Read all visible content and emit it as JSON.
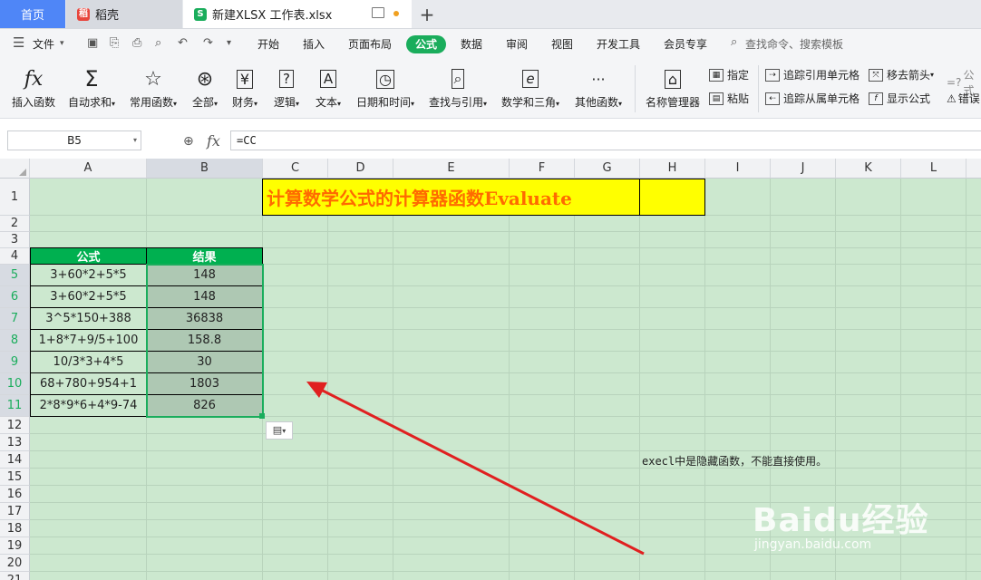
{
  "tabs": {
    "home": "首页",
    "daoke": "稻壳",
    "file": "新建XLSX 工作表.xlsx",
    "add": "+"
  },
  "menu": {
    "file": "文件",
    "items": [
      "开始",
      "插入",
      "页面布局",
      "公式",
      "数据",
      "审阅",
      "视图",
      "开发工具",
      "会员专享"
    ],
    "search": "查找命令、搜索模板"
  },
  "ribbon": {
    "big": [
      "插入函数",
      "自动求和",
      "常用函数",
      "全部",
      "财务",
      "逻辑",
      "文本",
      "日期和时间",
      "查找与引用",
      "数学和三角",
      "其他函数",
      "名称管理器"
    ],
    "small": [
      "指定",
      "粘贴",
      "追踪引用单元格",
      "追踪从属单元格",
      "移去箭头",
      "显示公式",
      "公式",
      "错误"
    ]
  },
  "formula_bar": {
    "name_box": "B5",
    "fx": "fx",
    "value": "=CC"
  },
  "columns": [
    "A",
    "B",
    "C",
    "D",
    "E",
    "F",
    "G",
    "H",
    "I",
    "J",
    "K",
    "L"
  ],
  "rows": [
    "1",
    "2",
    "3",
    "4",
    "5",
    "6",
    "7",
    "8",
    "9",
    "10",
    "11",
    "12",
    "13",
    "14",
    "15",
    "16",
    "17",
    "18",
    "19",
    "20",
    "21"
  ],
  "sheet": {
    "title": "计算数学公式的计算器函数Evaluate",
    "headers": [
      "公式",
      "结果"
    ],
    "data": [
      [
        "3+60*2+5*5",
        "148"
      ],
      [
        "3+60*2+5*5",
        "148"
      ],
      [
        "3^5*150+388",
        "36838"
      ],
      [
        "1+8*7+9/5+100",
        "158.8"
      ],
      [
        "10/3*3+4*5",
        "30"
      ],
      [
        "68+780+954+1",
        "1803"
      ],
      [
        "2*8*9*6+4*9-74",
        "826"
      ]
    ],
    "note": "execl中是隐藏函数，不能直接使用。"
  },
  "watermark": {
    "brand": "Baidu经验",
    "url": "jingyan.baidu.com"
  },
  "colors": {
    "accent": "#1aad5c",
    "sheet_bg": "#cce8cf",
    "title_bg": "#ffff00",
    "title_fg": "#ff6a00",
    "header_bg": "#00b050",
    "arrow": "#e02020"
  }
}
